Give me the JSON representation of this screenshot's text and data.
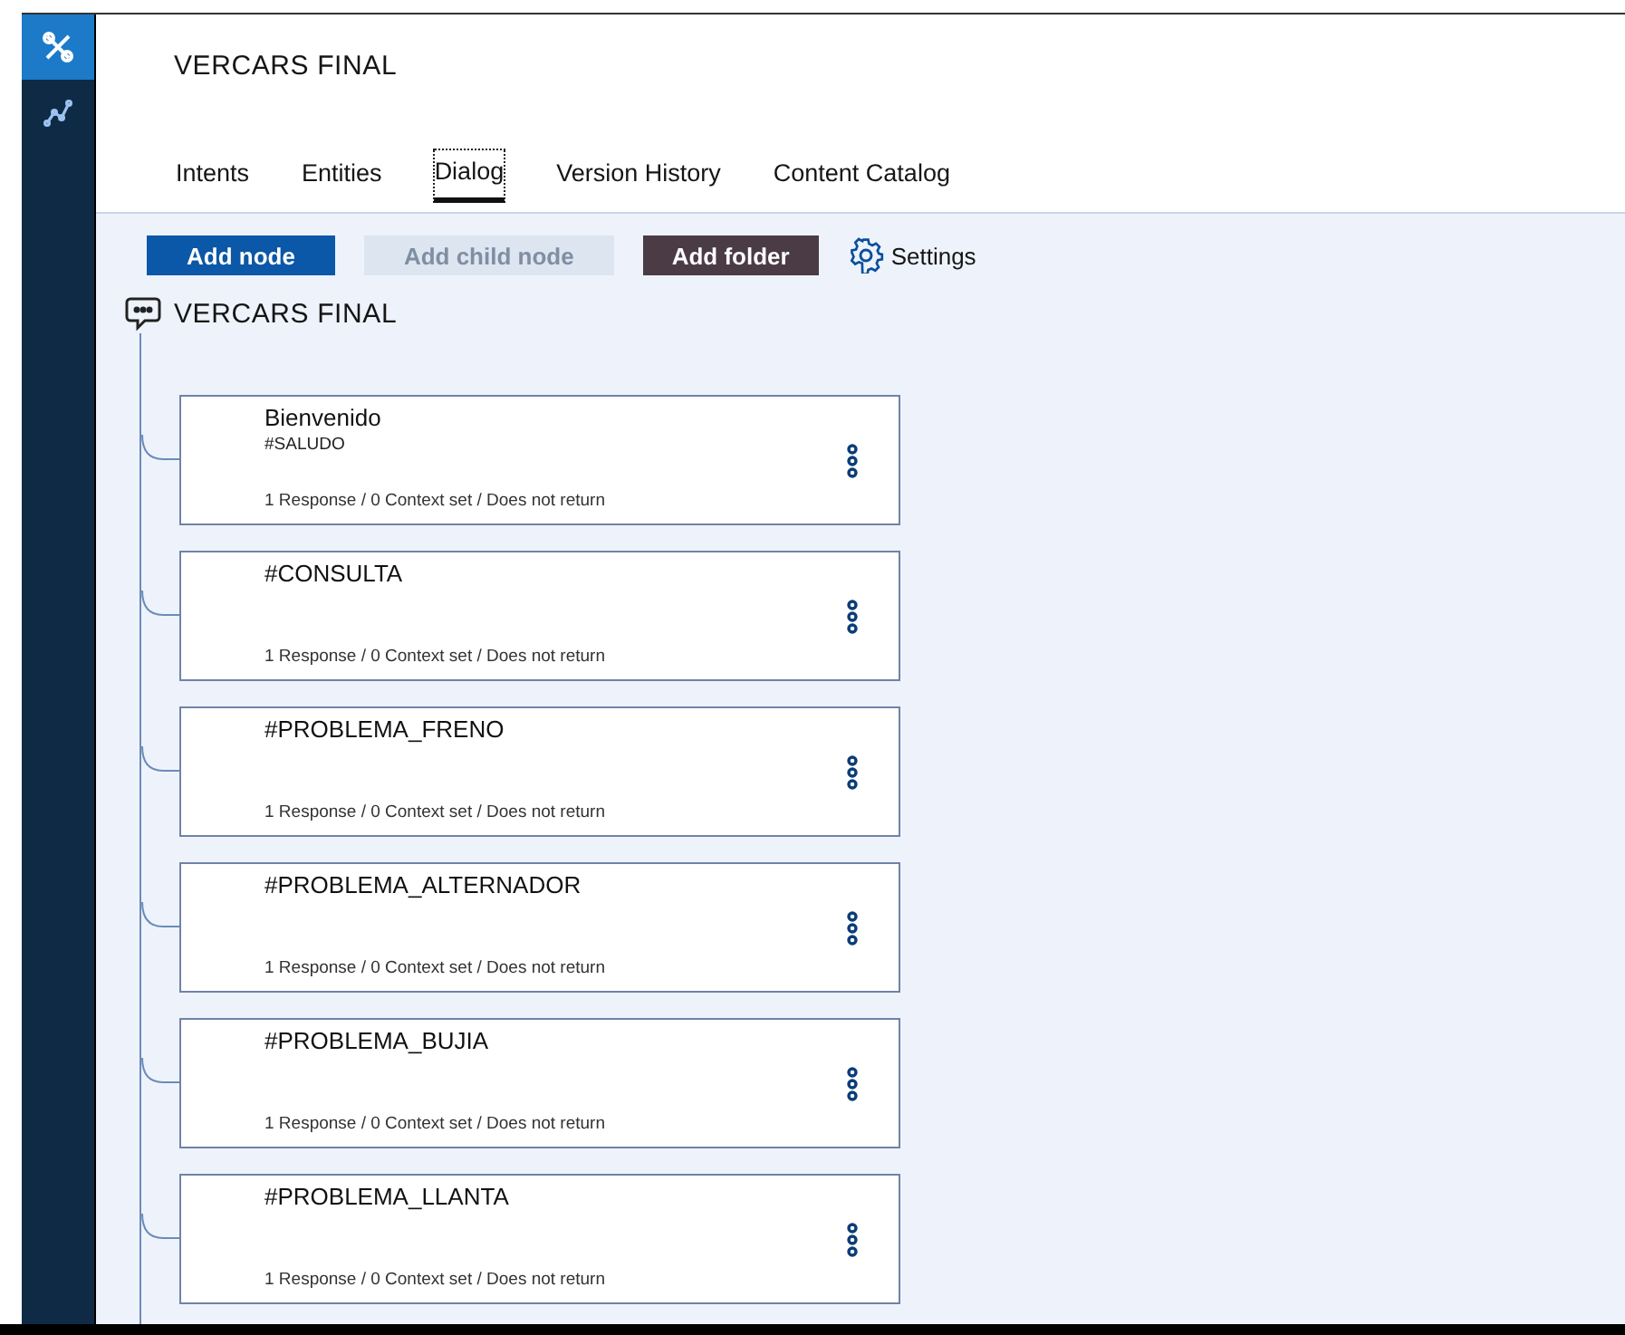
{
  "sidebar": {
    "items": [
      {
        "kind": "tools",
        "selected": true
      },
      {
        "kind": "analytics",
        "selected": false
      }
    ]
  },
  "title": "VERCARS FINAL",
  "tabs": [
    {
      "label": "Intents",
      "selected": false
    },
    {
      "label": "Entities",
      "selected": false
    },
    {
      "label": "Dialog",
      "selected": true
    },
    {
      "label": "Version History",
      "selected": false
    },
    {
      "label": "Content Catalog",
      "selected": false
    }
  ],
  "toolbar": [
    {
      "kind": "primary",
      "label": "Add node",
      "disabled": false
    },
    {
      "kind": "primary",
      "label": "Add child node",
      "disabled": true
    },
    {
      "kind": "folder",
      "label": "Add folder",
      "disabled": false
    },
    {
      "kind": "settings",
      "label": "Settings",
      "disabled": false
    }
  ],
  "dialog": {
    "root": "VERCARS FINAL",
    "nodes": [
      {
        "title": "Bienvenido",
        "condition": "#SALUDO",
        "summary": "1 Response / 0 Context set / Does not return"
      },
      {
        "title": "#CONSULTA",
        "summary": "1 Response / 0 Context set / Does not return"
      },
      {
        "title": "#PROBLEMA_FRENO",
        "summary": "1 Response / 0 Context set / Does not return"
      },
      {
        "title": "#PROBLEMA_ALTERNADOR",
        "summary": "1 Response / 0 Context set / Does not return"
      },
      {
        "title": "#PROBLEMA_BUJIA",
        "summary": "1 Response / 0 Context set / Does not return"
      },
      {
        "title": "#PROBLEMA_LLANTA",
        "summary": "1 Response / 0 Context set / Does not return"
      }
    ]
  }
}
